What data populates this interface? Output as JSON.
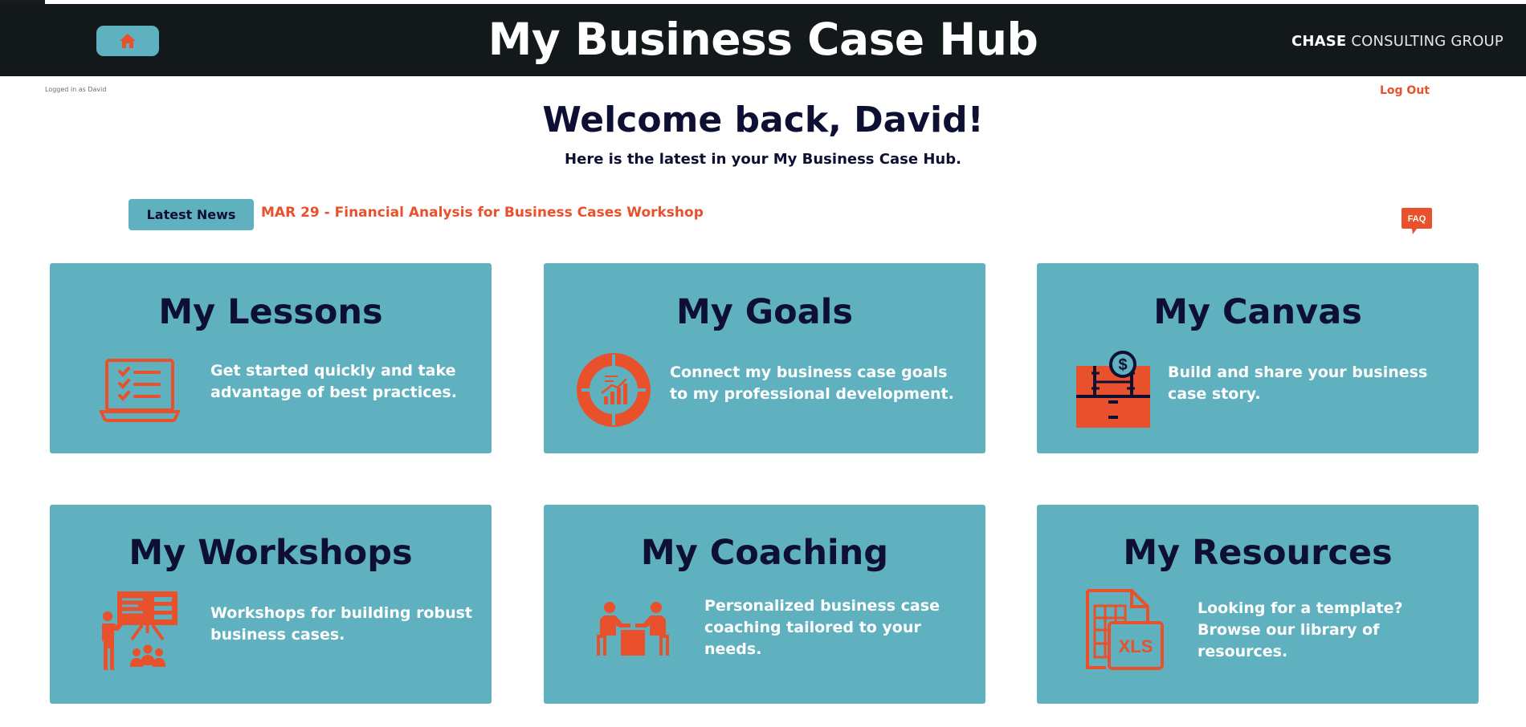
{
  "header": {
    "title": "My Business Case Hub",
    "brand_bold": "CHASE",
    "brand_rest": " CONSULTING GROUP",
    "home_icon": "home-icon"
  },
  "session": {
    "logged_in": "Logged in as David",
    "logout_label": "Log Out"
  },
  "welcome": {
    "heading": "Welcome back, David!",
    "subheading": "Here is the latest in your My Business Case Hub."
  },
  "news": {
    "button_label": "Latest News",
    "headline": "MAR 29 - Financial Analysis for Business Cases Workshop"
  },
  "faq": {
    "label": "FAQ",
    "icon": "faq-bubble-icon"
  },
  "cards": [
    {
      "title": "My Lessons",
      "description": "Get started quickly and take advantage of best practices.",
      "icon": "laptop-checklist-icon"
    },
    {
      "title": "My Goals",
      "description": "Connect my business case goals to my professional development.",
      "icon": "growth-chart-donut-icon"
    },
    {
      "title": "My Canvas",
      "description": "Build and share your business case story.",
      "icon": "canvas-board-dollar-icon"
    },
    {
      "title": "My Workshops",
      "description": "Workshops for building robust business cases.",
      "icon": "presentation-audience-icon"
    },
    {
      "title": "My Coaching",
      "description": "Personalized business case coaching tailored to your needs.",
      "icon": "coaching-meeting-icon"
    },
    {
      "title": "My Resources",
      "description": "Looking for a template? Browse our library of resources.",
      "icon": "xls-template-icon"
    }
  ],
  "colors": {
    "header_bg": "#13181b",
    "card_bg": "#5fb1bf",
    "accent": "#e8512b",
    "navy": "#0d1033"
  }
}
